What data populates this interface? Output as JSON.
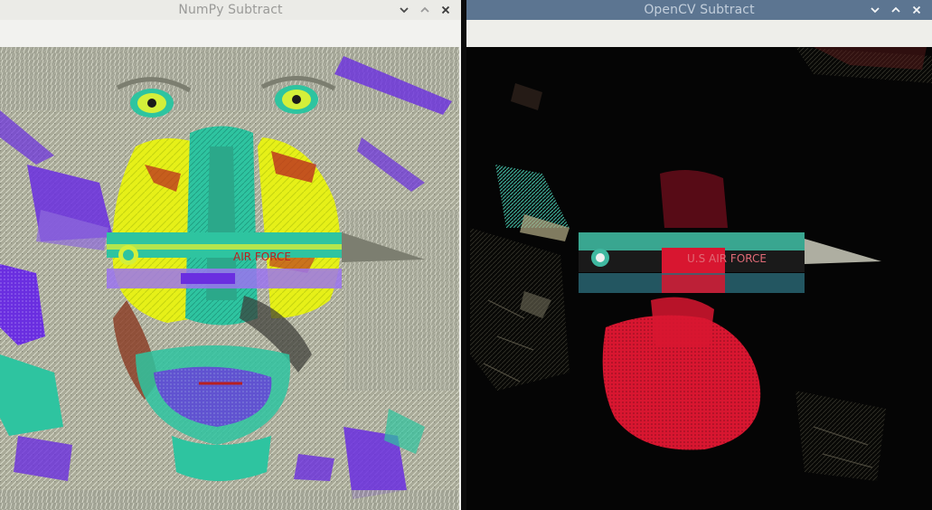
{
  "left_window": {
    "title": "NumPy Subtract",
    "controls": [
      "minimize-icon",
      "maximize-icon",
      "close-icon"
    ],
    "image_text": "AIR FORCE"
  },
  "right_window": {
    "title": "OpenCV Subtract",
    "controls": [
      "minimize-icon",
      "maximize-icon",
      "close-icon"
    ],
    "image_text": "U.S AIR FORCE"
  },
  "colors": {
    "left_titlebar": "#ebebe7",
    "right_titlebar": "#5c7591",
    "numpy_yellow": "#e6f018",
    "numpy_teal": "#2ec4a0",
    "numpy_purple": "#6a2ee0",
    "opencv_red": "#d81630",
    "opencv_teal": "#3fb8a0"
  }
}
